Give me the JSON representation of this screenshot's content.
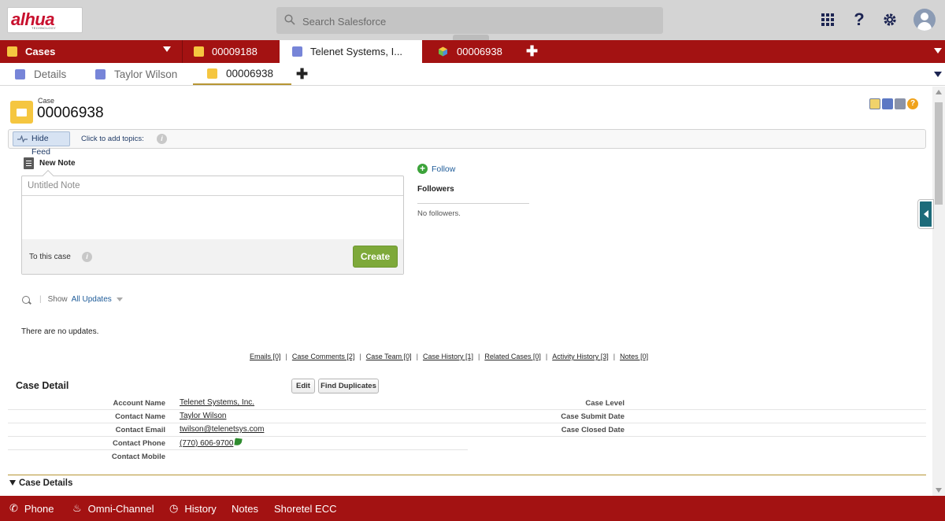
{
  "header": {
    "logo_text": "alhua",
    "logo_tagline": "TECHNOLOGY",
    "search_placeholder": "Search Salesforce",
    "help_glyph": "?",
    "icons": [
      "app-launcher-icon",
      "help-icon",
      "setup-gear-icon",
      "user-avatar-icon"
    ]
  },
  "workspace_tabs": {
    "nav_label": "Cases",
    "tabs": [
      {
        "label": "00009188",
        "icon": "case-icon",
        "active": false
      },
      {
        "label": "Telenet Systems, I...",
        "icon": "account-icon",
        "active": true
      },
      {
        "label": "00006938",
        "icon": "case-icon",
        "active": false
      }
    ],
    "add_glyph": "✚"
  },
  "sub_tabs": {
    "tabs": [
      {
        "label": "Details",
        "icon": "account-icon"
      },
      {
        "label": "Taylor Wilson",
        "icon": "contact-icon"
      },
      {
        "label": "00006938",
        "icon": "case-icon",
        "active": true
      }
    ],
    "add_glyph": "✚"
  },
  "case": {
    "object_label": "Case",
    "number": "00006938",
    "tool_help": "?"
  },
  "feed": {
    "hide_feed_label": "Hide Feed",
    "add_topics": "Click to add topics:",
    "new_note_label": "New Note",
    "note_title_placeholder": "Untitled Note",
    "to_this_case": "To this case",
    "create_label": "Create",
    "follow_label": "Follow",
    "followers_label": "Followers",
    "no_followers": "No followers.",
    "show_label": "Show",
    "filter_value": "All Updates",
    "no_updates": "There are no updates."
  },
  "related_links": [
    "Emails [0]",
    "Case Comments [2]",
    "Case Team [0]",
    "Case History [1]",
    "Related Cases [0]",
    "Activity History [3]",
    "Notes [0]"
  ],
  "case_detail": {
    "title": "Case Detail",
    "edit_label": "Edit",
    "find_duplicates_label": "Find Duplicates",
    "left_fields": [
      {
        "label": "Account Name",
        "value": "Telenet Systems, Inc."
      },
      {
        "label": "Contact Name",
        "value": "Taylor Wilson"
      },
      {
        "label": "Contact Email",
        "value": "twilson@telenetsys.com"
      },
      {
        "label": "Contact Phone",
        "value": "(770) 606-9700"
      },
      {
        "label": "Contact Mobile",
        "value": ""
      }
    ],
    "right_fields": [
      {
        "label": "Case Level",
        "value": ""
      },
      {
        "label": "Case Submit Date",
        "value": ""
      },
      {
        "label": "Case Closed Date",
        "value": ""
      }
    ],
    "section_label": "Case Details"
  },
  "footer": {
    "items": [
      {
        "label": "Phone",
        "icon": "phone-icon"
      },
      {
        "label": "Omni-Channel",
        "icon": "omni-channel-icon"
      },
      {
        "label": "History",
        "icon": "clock-icon"
      },
      {
        "label": "Notes",
        "icon": ""
      },
      {
        "label": "Shoretel ECC",
        "icon": ""
      }
    ]
  },
  "colors": {
    "brand_bar": "#a31212",
    "header_bg": "#d4d4d4",
    "case_icon": "#f5c640",
    "account_icon": "#7785d8",
    "create_button": "#7ea93a",
    "link": "#1f5c99"
  }
}
